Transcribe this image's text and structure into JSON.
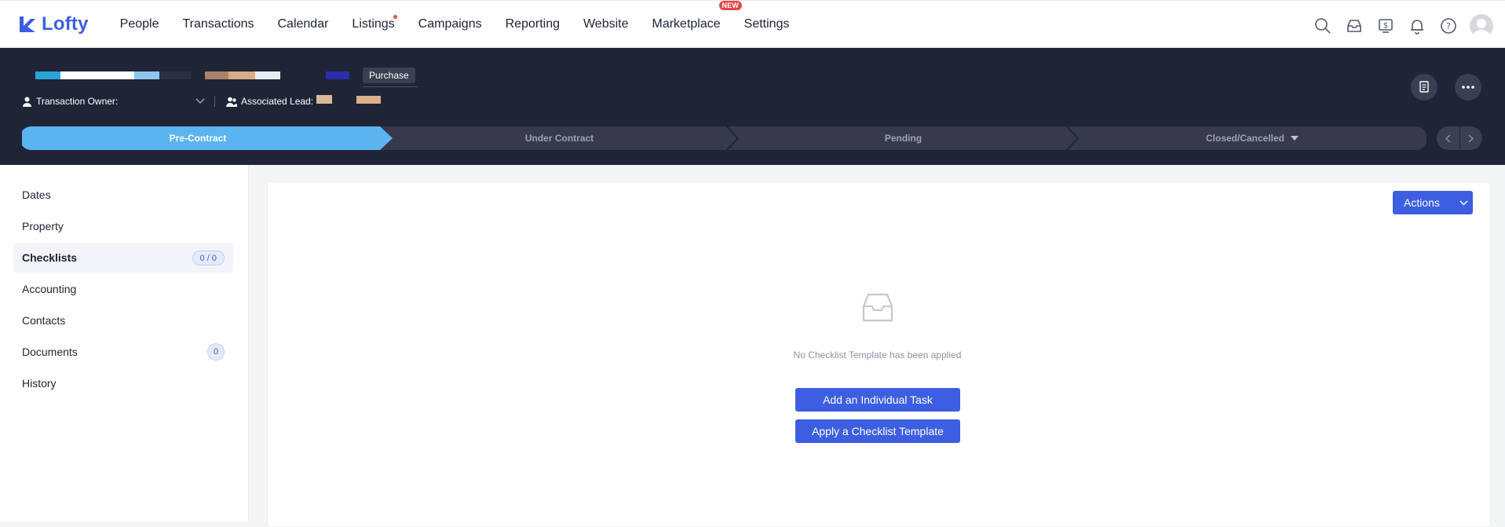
{
  "brand": {
    "name": "Lofty",
    "color": "#3d5ee0"
  },
  "nav": {
    "items": [
      {
        "label": "People",
        "id": "people"
      },
      {
        "label": "Transactions",
        "id": "transactions"
      },
      {
        "label": "Calendar",
        "id": "calendar"
      },
      {
        "label": "Listings",
        "id": "listings",
        "dot": true
      },
      {
        "label": "Campaigns",
        "id": "campaigns"
      },
      {
        "label": "Reporting",
        "id": "reporting"
      },
      {
        "label": "Website",
        "id": "website"
      },
      {
        "label": "Marketplace",
        "id": "marketplace",
        "badge": "NEW"
      },
      {
        "label": "Settings",
        "id": "settings"
      }
    ],
    "icons": [
      "search-icon",
      "inbox-icon",
      "billing-icon",
      "bell-icon",
      "help-icon",
      "avatar"
    ]
  },
  "transaction": {
    "type_badge": "Purchase",
    "owner_label": "Transaction Owner:",
    "lead_label": "Associated Lead:"
  },
  "stages": {
    "items": [
      "Pre-Contract",
      "Under Contract",
      "Pending",
      "Closed/Cancelled"
    ],
    "active": "Pre-Contract",
    "active_color": "#5bb4f0",
    "inactive_color": "#363a4c"
  },
  "sidebar": {
    "items": [
      {
        "label": "Dates"
      },
      {
        "label": "Property"
      },
      {
        "label": "Checklists",
        "badge": "0 / 0",
        "active": true
      },
      {
        "label": "Accounting"
      },
      {
        "label": "Contacts"
      },
      {
        "label": "Documents",
        "badge": "0"
      },
      {
        "label": "History"
      }
    ]
  },
  "checklists": {
    "actions_label": "Actions",
    "empty_message": "No Checklist Template has been applied",
    "add_task_label": "Add an Individual Task",
    "apply_template_label": "Apply a Checklist Template"
  }
}
